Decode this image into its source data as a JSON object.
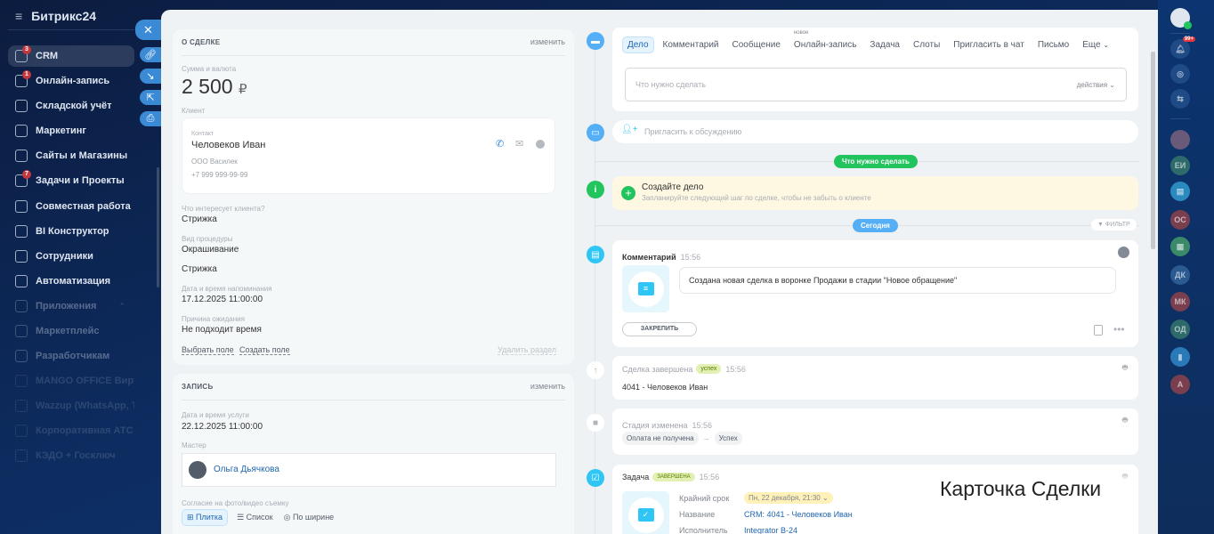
{
  "app": {
    "logo": "Битрикс24",
    "logo_mark": "©"
  },
  "sidebar": {
    "items": [
      {
        "label": "CRM",
        "badge": "3",
        "icon": "funnel-icon"
      },
      {
        "label": "Онлайн-запись",
        "badge": "1",
        "icon": "calendar-icon"
      },
      {
        "label": "Складской учёт",
        "icon": "warehouse-icon"
      },
      {
        "label": "Маркетинг",
        "icon": "target-icon"
      },
      {
        "label": "Сайты и Магазины",
        "icon": "cart-icon"
      },
      {
        "label": "Задачи и Проекты",
        "badge": "7",
        "icon": "tasks-icon"
      },
      {
        "label": "Совместная работа",
        "icon": "collab-icon"
      },
      {
        "label": "BI Конструктор",
        "icon": "chart-icon"
      },
      {
        "label": "Сотрудники",
        "icon": "employees-icon"
      },
      {
        "label": "Автоматизация",
        "icon": "robot-icon"
      },
      {
        "label": "Приложения",
        "icon": "apps-icon"
      },
      {
        "label": "Маркетплейс",
        "icon": "marketplace-icon"
      },
      {
        "label": "Разработчикам",
        "icon": "code-icon"
      },
      {
        "label": "MANGO OFFICE Вирт...",
        "icon": "mango-icon"
      },
      {
        "label": "Wazzup (WhatsApp, T...",
        "icon": "wazzup-icon"
      },
      {
        "label": "Корпоративная АТС ...",
        "icon": "pbx-icon"
      },
      {
        "label": "КЭДО + Госключ",
        "icon": "kedo-icon"
      }
    ]
  },
  "deal": {
    "title": "О СДЕЛКЕ",
    "edit": "изменить",
    "sum_label": "Сумма и валюта",
    "sum": "2 500",
    "currency": "₽",
    "client_label": "Клиент",
    "contact_label": "Контакт",
    "contact_name": "Человеков Иван",
    "company": "ООО Василек",
    "phone": "+7 999 999-99-99",
    "fields": [
      {
        "label": "Что интересует клиента?",
        "value": "Стрижка"
      },
      {
        "label": "Вид процедуры",
        "value": "Окрашивание",
        "value2": "Стрижка"
      },
      {
        "label": "Дата и время напоминания",
        "value": "17.12.2025 11:00:00"
      },
      {
        "label": "Причина ожидания",
        "value": "Не подходит время"
      }
    ],
    "select_field": "Выбрать поле",
    "create_field": "Создать поле",
    "delete_section": "Удалить раздел"
  },
  "booking": {
    "title": "ЗАПИСЬ",
    "edit": "изменить",
    "date_label": "Дата и время услуги",
    "date": "22.12.2025 11:00:00",
    "master_label": "Мастер",
    "master": "Ольга Дьячкова",
    "consent_label": "Согласие на фото/видео съемку",
    "views": [
      "Плитка",
      "Список",
      "По ширине"
    ]
  },
  "timeline": {
    "tabs": [
      "Дело",
      "Комментарий",
      "Сообщение",
      "Онлайн-запись",
      "Задача",
      "Слоты",
      "Пригласить в чат",
      "Письмо",
      "Еще"
    ],
    "new_badge": "новое",
    "todo_placeholder": "Что нужно сделать",
    "actions": "действия",
    "invite_placeholder": "Пригласить к обсуждению",
    "todo_divider": "Что нужно сделать",
    "create_title": "Создайте дело",
    "create_sub": "Запланируйте следующий шаг по сделке, чтобы не забыть о клиенте",
    "today": "Сегодня",
    "filter": "ФИЛЬТР",
    "comment": {
      "title": "Комментарий",
      "time": "15:56",
      "text": "Создана новая сделка в воронке Продажи в стадии \"Новое обращение\"",
      "pin": "ЗАКРЕПИТЬ"
    },
    "closed": {
      "title": "Сделка завершена",
      "badge": "успех",
      "time": "15:56",
      "text": "4041 - Человеков Иван"
    },
    "stage": {
      "title": "Стадия изменена",
      "time": "15:56",
      "from": "Оплата не получена",
      "arrow": "→",
      "to": "Успех"
    },
    "task": {
      "title": "Задача",
      "badge": "завершена",
      "time": "15:56",
      "deadline_label": "Крайний срок",
      "deadline": "Пн, 22 декабря, 21:30",
      "name_label": "Название",
      "name": "CRM: 4041 - Человеков Иван",
      "assignee_label": "Исполнитель",
      "assignee": "Integrator B-24"
    }
  },
  "overlay_caption": "Карточка Сделки",
  "rail": {
    "notif_badge": "99+",
    "avatars": [
      "ЕИ",
      "ОС",
      "ДК",
      "МК",
      "ОД",
      "А"
    ]
  },
  "colors": {
    "accent": "#2fc6f6",
    "green": "#21c45d",
    "link": "#2067b0"
  }
}
